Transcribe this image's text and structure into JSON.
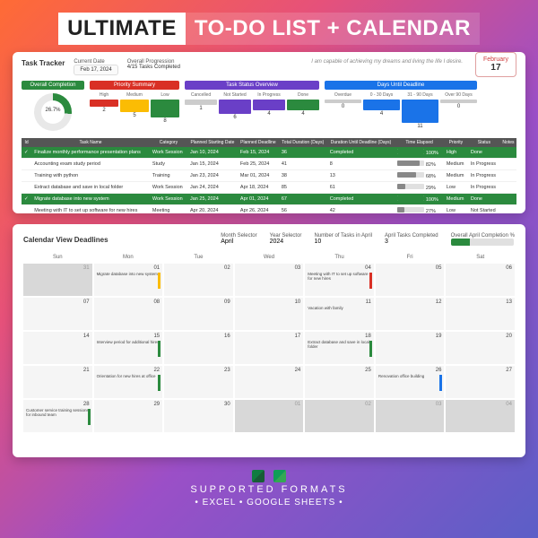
{
  "title": {
    "left": "ULTIMATE",
    "right": "TO-DO LIST + CALENDAR"
  },
  "tracker": {
    "heading": "Task Tracker",
    "current_date_label": "Current Date",
    "current_date": "Feb 17, 2024",
    "progression_label": "Overall Progression",
    "progression": "4/15 Tasks Completed",
    "quote": "I am capable of achieving my dreams and living the life I desire.",
    "badge": {
      "month": "February",
      "day": "17"
    },
    "overall": {
      "label": "Overall Completion",
      "pct": "26.7%"
    },
    "priority": {
      "label": "Priority Summary",
      "cols": [
        {
          "h": "High",
          "c": "#d93025",
          "v": "2"
        },
        {
          "h": "Medium",
          "c": "#fbbc04",
          "v": "5"
        },
        {
          "h": "Low",
          "c": "#2b8a3e",
          "v": "8"
        }
      ]
    },
    "status": {
      "label": "Task Status Overview",
      "cols": [
        {
          "h": "Cancelled",
          "c": "#ccc",
          "v": "1"
        },
        {
          "h": "Not Started",
          "c": "#6a3fc7",
          "v": "6"
        },
        {
          "h": "In Progress",
          "c": "#6a3fc7",
          "v": "4"
        },
        {
          "h": "Done",
          "c": "#2b8a3e",
          "v": "4"
        }
      ]
    },
    "days": {
      "label": "Days Until Deadline",
      "cols": [
        {
          "h": "Overdue",
          "c": "#ccc",
          "v": "0"
        },
        {
          "h": "0 - 30 Days",
          "c": "#1a73e8",
          "v": "4"
        },
        {
          "h": "31 - 90 Days",
          "c": "#1a73e8",
          "v": "11"
        },
        {
          "h": "Over 90 Days",
          "c": "#ccc",
          "v": "0"
        }
      ]
    }
  },
  "table": {
    "headers": [
      "Id",
      "Task Name",
      "Category",
      "Planned Starting Date",
      "Planned Deadline",
      "Total Duration (Days)",
      "Duration Until Deadline (Days)",
      "Time Elapsed",
      "Priority",
      "Status",
      "Notes"
    ],
    "rows": [
      {
        "hl": true,
        "cells": [
          "✓",
          "Finalize monthly performance presentation plans",
          "Work Session",
          "Jan 10, 2024",
          "Feb 15, 2024",
          "36",
          "Completed",
          "100%",
          "High",
          "Done",
          ""
        ]
      },
      {
        "cells": [
          "",
          "Accounting exam study period",
          "Study",
          "Jan 15, 2024",
          "Feb 25, 2024",
          "41",
          "8",
          "82%",
          "Medium",
          "In Progress",
          ""
        ]
      },
      {
        "cells": [
          "",
          "Training with python",
          "Training",
          "Jan 23, 2024",
          "Mar 01, 2024",
          "38",
          "13",
          "68%",
          "Medium",
          "In Progress",
          ""
        ]
      },
      {
        "cells": [
          "",
          "Extract database and save in local folder",
          "Work Session",
          "Jan 24, 2024",
          "Apr 18, 2024",
          "85",
          "61",
          "29%",
          "Low",
          "In Progress",
          ""
        ]
      },
      {
        "hl": true,
        "cells": [
          "✓",
          "Migrate database into new system",
          "Work Session",
          "Jan 25, 2024",
          "Apr 01, 2024",
          "67",
          "Completed",
          "100%",
          "Medium",
          "Done",
          ""
        ]
      },
      {
        "cells": [
          "",
          "Meeting with IT to set up software for new hires",
          "Meeting",
          "Apr 20, 2024",
          "Apr 26, 2024",
          "56",
          "42",
          "27%",
          "Low",
          "Not Started",
          ""
        ]
      }
    ]
  },
  "calendar": {
    "heading": "Calendar View Deadlines",
    "selectors": [
      {
        "l": "Month Selector",
        "v": "April"
      },
      {
        "l": "Year Selector",
        "v": "2024"
      },
      {
        "l": "Number of Tasks in April",
        "v": "10"
      },
      {
        "l": "April Tasks Completed",
        "v": "3"
      },
      {
        "l": "Overall April Completion %",
        "v": ""
      }
    ],
    "dow": [
      "Sun",
      "Mon",
      "Tue",
      "Wed",
      "Thu",
      "Fri",
      "Sat"
    ],
    "cells": [
      {
        "d": "31",
        "g": 1
      },
      {
        "d": "01",
        "e": "Migrate database into new system",
        "m": "y"
      },
      {
        "d": "02"
      },
      {
        "d": "03"
      },
      {
        "d": "04",
        "e": "Meeting with IT to set up software for new hires",
        "m": "r"
      },
      {
        "d": "05"
      },
      {
        "d": "06"
      },
      {
        "d": "07"
      },
      {
        "d": "08"
      },
      {
        "d": "09"
      },
      {
        "d": "10"
      },
      {
        "d": "11",
        "e": "Vacation with family"
      },
      {
        "d": "12"
      },
      {
        "d": "13"
      },
      {
        "d": "14"
      },
      {
        "d": "15",
        "e": "Interview period for additional hires",
        "m": "g"
      },
      {
        "d": "16"
      },
      {
        "d": "17"
      },
      {
        "d": "18",
        "e": "Extract database and save in local folder",
        "m": "g"
      },
      {
        "d": "19"
      },
      {
        "d": "20"
      },
      {
        "d": "21"
      },
      {
        "d": "22",
        "e": "Orientation for new hires at office",
        "m": "g"
      },
      {
        "d": "23"
      },
      {
        "d": "24"
      },
      {
        "d": "25"
      },
      {
        "d": "26",
        "e": "Renovation office building",
        "m": "b"
      },
      {
        "d": "27"
      },
      {
        "d": "28",
        "e": "Customer service training sessions for inbound team",
        "m": "g"
      },
      {
        "d": "29"
      },
      {
        "d": "30"
      },
      {
        "d": "01",
        "g": 1
      },
      {
        "d": "02",
        "g": 1
      },
      {
        "d": "03",
        "g": 1
      },
      {
        "d": "04",
        "g": 1
      }
    ]
  },
  "footer": {
    "sf": "SUPPORTED FORMATS",
    "line": "• EXCEL • GOOGLE SHEETS •"
  }
}
